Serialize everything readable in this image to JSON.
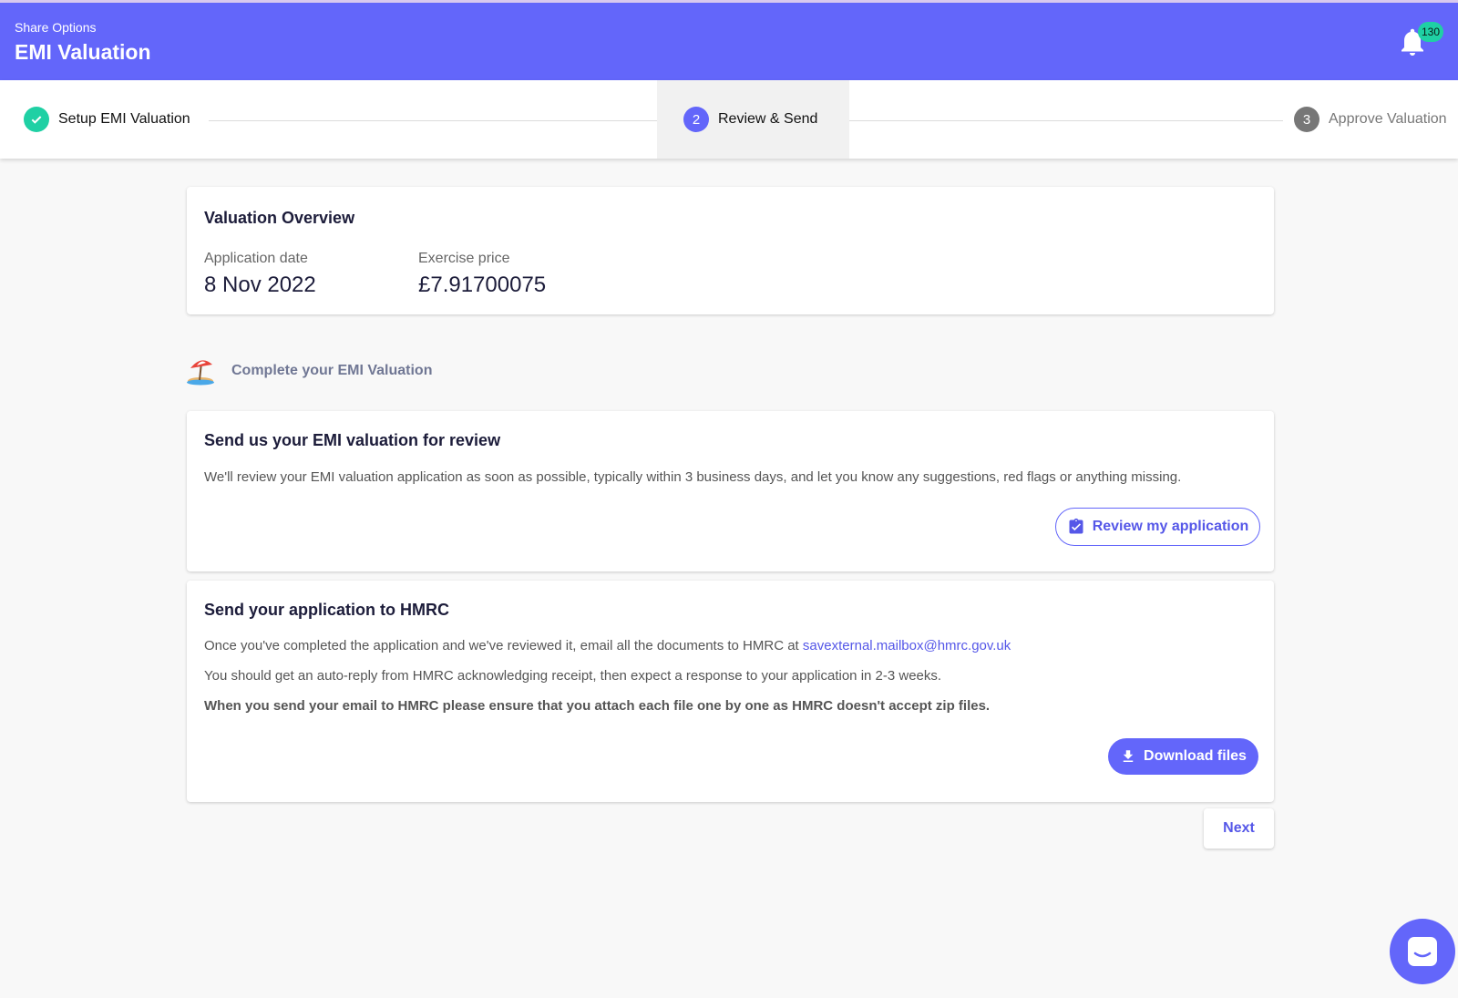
{
  "app_bar": {
    "subtitle": "Share Options",
    "title": "EMI Valuation",
    "notification_count": "130"
  },
  "stepper": {
    "steps": [
      {
        "label": "Setup EMI Valuation",
        "state": "done",
        "number": ""
      },
      {
        "label": "Review & Send",
        "state": "active",
        "number": "2"
      },
      {
        "label": "Approve Valuation",
        "state": "pending",
        "number": "3"
      }
    ]
  },
  "overview": {
    "title": "Valuation Overview",
    "application_date_label": "Application date",
    "application_date": "8 Nov 2022",
    "exercise_price_label": "Exercise price",
    "exercise_price": "£7.91700075"
  },
  "section": {
    "title": "Complete your EMI Valuation",
    "icon": "beach-umbrella-icon"
  },
  "review_card": {
    "title": "Send us your EMI valuation for review",
    "text": "We'll review your EMI valuation application as soon as possible, typically within 3 business days, and let you know any suggestions, red flags or anything missing.",
    "button_label": "Review my application"
  },
  "hmrc_card": {
    "title": "Send your application to HMRC",
    "line1_prefix": "Once you've completed the application and we've reviewed it, email all the documents to HMRC at ",
    "email": "savexternal.mailbox@hmrc.gov.uk",
    "line2": "You should get an auto-reply from HMRC acknowledging receipt, then expect a response to your application in 2-3 weeks.",
    "line3": "When you send your email to HMRC please ensure that you attach each file one by one as HMRC doesn't accept zip files.",
    "button_label": "Download files"
  },
  "footer": {
    "next_label": "Next"
  },
  "colors": {
    "primary": "#6366fa",
    "success": "#1fd0a4",
    "link": "#5557e8"
  }
}
